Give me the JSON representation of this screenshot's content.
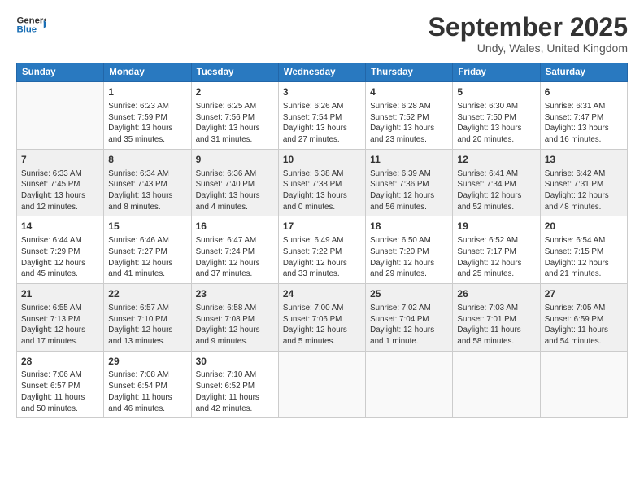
{
  "logo": {
    "line1": "General",
    "line2": "Blue",
    "arrow_color": "#1a6fb5"
  },
  "title": "September 2025",
  "subtitle": "Undy, Wales, United Kingdom",
  "days_of_week": [
    "Sunday",
    "Monday",
    "Tuesday",
    "Wednesday",
    "Thursday",
    "Friday",
    "Saturday"
  ],
  "weeks": [
    [
      {
        "day": "",
        "info": ""
      },
      {
        "day": "1",
        "info": "Sunrise: 6:23 AM\nSunset: 7:59 PM\nDaylight: 13 hours\nand 35 minutes."
      },
      {
        "day": "2",
        "info": "Sunrise: 6:25 AM\nSunset: 7:56 PM\nDaylight: 13 hours\nand 31 minutes."
      },
      {
        "day": "3",
        "info": "Sunrise: 6:26 AM\nSunset: 7:54 PM\nDaylight: 13 hours\nand 27 minutes."
      },
      {
        "day": "4",
        "info": "Sunrise: 6:28 AM\nSunset: 7:52 PM\nDaylight: 13 hours\nand 23 minutes."
      },
      {
        "day": "5",
        "info": "Sunrise: 6:30 AM\nSunset: 7:50 PM\nDaylight: 13 hours\nand 20 minutes."
      },
      {
        "day": "6",
        "info": "Sunrise: 6:31 AM\nSunset: 7:47 PM\nDaylight: 13 hours\nand 16 minutes."
      }
    ],
    [
      {
        "day": "7",
        "info": "Sunrise: 6:33 AM\nSunset: 7:45 PM\nDaylight: 13 hours\nand 12 minutes."
      },
      {
        "day": "8",
        "info": "Sunrise: 6:34 AM\nSunset: 7:43 PM\nDaylight: 13 hours\nand 8 minutes."
      },
      {
        "day": "9",
        "info": "Sunrise: 6:36 AM\nSunset: 7:40 PM\nDaylight: 13 hours\nand 4 minutes."
      },
      {
        "day": "10",
        "info": "Sunrise: 6:38 AM\nSunset: 7:38 PM\nDaylight: 13 hours\nand 0 minutes."
      },
      {
        "day": "11",
        "info": "Sunrise: 6:39 AM\nSunset: 7:36 PM\nDaylight: 12 hours\nand 56 minutes."
      },
      {
        "day": "12",
        "info": "Sunrise: 6:41 AM\nSunset: 7:34 PM\nDaylight: 12 hours\nand 52 minutes."
      },
      {
        "day": "13",
        "info": "Sunrise: 6:42 AM\nSunset: 7:31 PM\nDaylight: 12 hours\nand 48 minutes."
      }
    ],
    [
      {
        "day": "14",
        "info": "Sunrise: 6:44 AM\nSunset: 7:29 PM\nDaylight: 12 hours\nand 45 minutes."
      },
      {
        "day": "15",
        "info": "Sunrise: 6:46 AM\nSunset: 7:27 PM\nDaylight: 12 hours\nand 41 minutes."
      },
      {
        "day": "16",
        "info": "Sunrise: 6:47 AM\nSunset: 7:24 PM\nDaylight: 12 hours\nand 37 minutes."
      },
      {
        "day": "17",
        "info": "Sunrise: 6:49 AM\nSunset: 7:22 PM\nDaylight: 12 hours\nand 33 minutes."
      },
      {
        "day": "18",
        "info": "Sunrise: 6:50 AM\nSunset: 7:20 PM\nDaylight: 12 hours\nand 29 minutes."
      },
      {
        "day": "19",
        "info": "Sunrise: 6:52 AM\nSunset: 7:17 PM\nDaylight: 12 hours\nand 25 minutes."
      },
      {
        "day": "20",
        "info": "Sunrise: 6:54 AM\nSunset: 7:15 PM\nDaylight: 12 hours\nand 21 minutes."
      }
    ],
    [
      {
        "day": "21",
        "info": "Sunrise: 6:55 AM\nSunset: 7:13 PM\nDaylight: 12 hours\nand 17 minutes."
      },
      {
        "day": "22",
        "info": "Sunrise: 6:57 AM\nSunset: 7:10 PM\nDaylight: 12 hours\nand 13 minutes."
      },
      {
        "day": "23",
        "info": "Sunrise: 6:58 AM\nSunset: 7:08 PM\nDaylight: 12 hours\nand 9 minutes."
      },
      {
        "day": "24",
        "info": "Sunrise: 7:00 AM\nSunset: 7:06 PM\nDaylight: 12 hours\nand 5 minutes."
      },
      {
        "day": "25",
        "info": "Sunrise: 7:02 AM\nSunset: 7:04 PM\nDaylight: 12 hours\nand 1 minute."
      },
      {
        "day": "26",
        "info": "Sunrise: 7:03 AM\nSunset: 7:01 PM\nDaylight: 11 hours\nand 58 minutes."
      },
      {
        "day": "27",
        "info": "Sunrise: 7:05 AM\nSunset: 6:59 PM\nDaylight: 11 hours\nand 54 minutes."
      }
    ],
    [
      {
        "day": "28",
        "info": "Sunrise: 7:06 AM\nSunset: 6:57 PM\nDaylight: 11 hours\nand 50 minutes."
      },
      {
        "day": "29",
        "info": "Sunrise: 7:08 AM\nSunset: 6:54 PM\nDaylight: 11 hours\nand 46 minutes."
      },
      {
        "day": "30",
        "info": "Sunrise: 7:10 AM\nSunset: 6:52 PM\nDaylight: 11 hours\nand 42 minutes."
      },
      {
        "day": "",
        "info": ""
      },
      {
        "day": "",
        "info": ""
      },
      {
        "day": "",
        "info": ""
      },
      {
        "day": "",
        "info": ""
      }
    ]
  ]
}
